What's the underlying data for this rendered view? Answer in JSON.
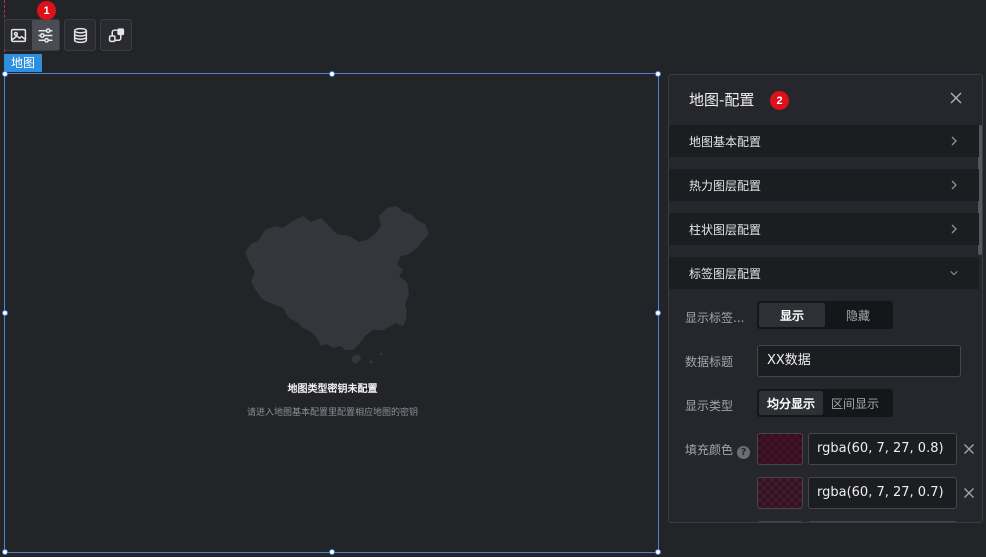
{
  "toolbar": {
    "buttons": [
      {
        "name": "image-icon",
        "active": false
      },
      {
        "name": "sliders-icon",
        "active": true
      },
      {
        "name": "database-icon",
        "active": false
      },
      {
        "name": "interaction-icon",
        "active": false
      }
    ],
    "step_badge": "1"
  },
  "canvas": {
    "widget_tag": "地图",
    "empty_title": "地图类型密钥未配置",
    "empty_subtitle": "请进入地图基本配置里配置相应地图的密钥"
  },
  "panel": {
    "title": "地图-配置",
    "step_badge": "2",
    "sections": [
      {
        "label": "地图基本配置",
        "expanded": false
      },
      {
        "label": "热力图层配置",
        "expanded": false
      },
      {
        "label": "柱状图层配置",
        "expanded": false
      },
      {
        "label": "标签图层配置",
        "expanded": true
      }
    ],
    "label_layer": {
      "show_label": {
        "label": "显示标签...",
        "options": [
          "显示",
          "隐藏"
        ],
        "selected": "显示"
      },
      "data_title": {
        "label": "数据标题",
        "value": "XX数据"
      },
      "display_type": {
        "label": "显示类型",
        "options": [
          "均分显示",
          "区间显示"
        ],
        "selected": "均分显示"
      },
      "fill_color": {
        "label": "填充颜色",
        "colors": [
          {
            "value": "rgba(60, 7, 27, 0.8)",
            "swatch": "#3c071b",
            "alpha": 0.8
          },
          {
            "value": "rgba(60, 7, 27, 0.7)",
            "swatch": "#3c071b",
            "alpha": 0.7
          }
        ]
      }
    }
  },
  "colors": {
    "accent": "#2f8fdf",
    "selection_border": "#4a84d6",
    "badge": "#e0101a",
    "background": "#232428",
    "panel": "#26272c"
  }
}
